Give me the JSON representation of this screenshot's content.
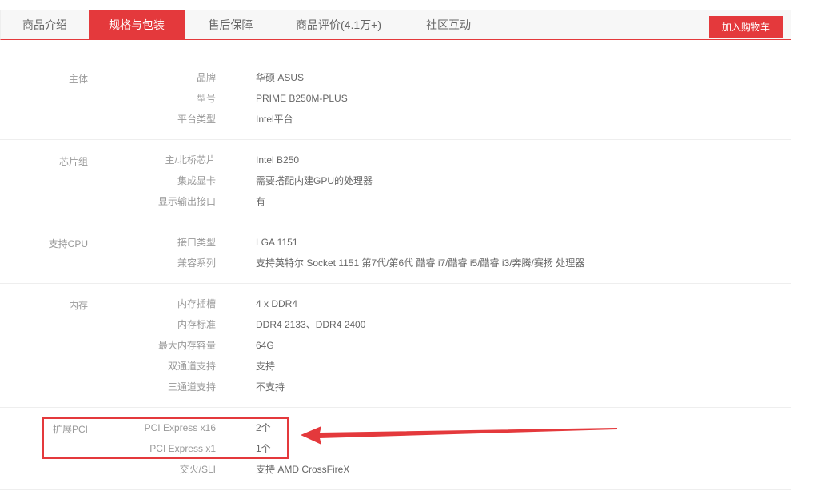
{
  "tabs": [
    {
      "label": "商品介绍"
    },
    {
      "label": "规格与包装"
    },
    {
      "label": "售后保障"
    },
    {
      "label": "商品评价(4.1万+)"
    },
    {
      "label": "社区互动"
    }
  ],
  "cart_button": "加入购物车",
  "groups": [
    {
      "name": "主体",
      "rows": [
        {
          "label": "品牌",
          "value": "华硕 ASUS"
        },
        {
          "label": "型号",
          "value": "PRIME B250M-PLUS"
        },
        {
          "label": "平台类型",
          "value": "Intel平台"
        }
      ]
    },
    {
      "name": "芯片组",
      "rows": [
        {
          "label": "主/北桥芯片",
          "value": "Intel B250"
        },
        {
          "label": "集成显卡",
          "value": "需要搭配内建GPU的处理器"
        },
        {
          "label": "显示输出接口",
          "value": "有"
        }
      ]
    },
    {
      "name": "支持CPU",
      "rows": [
        {
          "label": "接口类型",
          "value": "LGA 1151"
        },
        {
          "label": "兼容系列",
          "value": "支持英特尔 Socket 1151 第7代/第6代 酷睿 i7/酷睿 i5/酷睿 i3/奔腾/赛扬 处理器"
        }
      ]
    },
    {
      "name": "内存",
      "rows": [
        {
          "label": "内存插槽",
          "value": "4 x DDR4"
        },
        {
          "label": "内存标准",
          "value": "DDR4 2133、DDR4 2400"
        },
        {
          "label": "最大内存容量",
          "value": "64G"
        },
        {
          "label": "双通道支持",
          "value": "支持"
        },
        {
          "label": "三通道支持",
          "value": "不支持"
        }
      ]
    },
    {
      "name": "扩展PCI",
      "rows": [
        {
          "label": "PCI Express x16",
          "value": "2个"
        },
        {
          "label": "PCI Express x1",
          "value": "1个"
        },
        {
          "label": "交火/SLI",
          "value": "支持 AMD CrossFireX"
        }
      ]
    }
  ],
  "colors": {
    "accent": "#e4393c",
    "annotation": "#e4393c"
  }
}
